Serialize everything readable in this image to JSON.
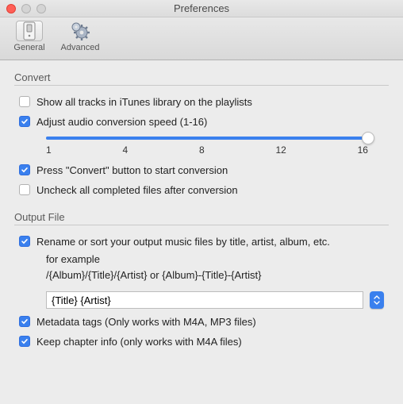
{
  "window": {
    "title": "Preferences"
  },
  "tabs": {
    "general": "General",
    "advanced": "Advanced"
  },
  "convert": {
    "section": "Convert",
    "show_all_tracks": {
      "label": "Show all tracks in iTunes library on the playlists",
      "checked": false
    },
    "adjust_speed": {
      "label": "Adjust audio conversion speed (1-16)",
      "checked": true
    },
    "slider": {
      "min": 1,
      "max": 16,
      "value": 16,
      "ticks": [
        "1",
        "4",
        "8",
        "12",
        "16"
      ]
    },
    "press_convert": {
      "label": "Press \"Convert\" button to start conversion",
      "checked": true
    },
    "uncheck_completed": {
      "label": "Uncheck all completed files after conversion",
      "checked": false
    }
  },
  "output": {
    "section": "Output File",
    "rename": {
      "label": "Rename or sort your output music files by title, artist, album, etc.",
      "checked": true
    },
    "example_intro": "for example",
    "example_pattern": "/{Album}/{Title}/{Artist} or {Album}-{Title}-{Artist}",
    "pattern_value": "{Title} {Artist}",
    "metadata": {
      "label": "Metadata tags (Only works with M4A, MP3 files)",
      "checked": true
    },
    "chapter": {
      "label": "Keep chapter info (only works with  M4A files)",
      "checked": true
    }
  }
}
